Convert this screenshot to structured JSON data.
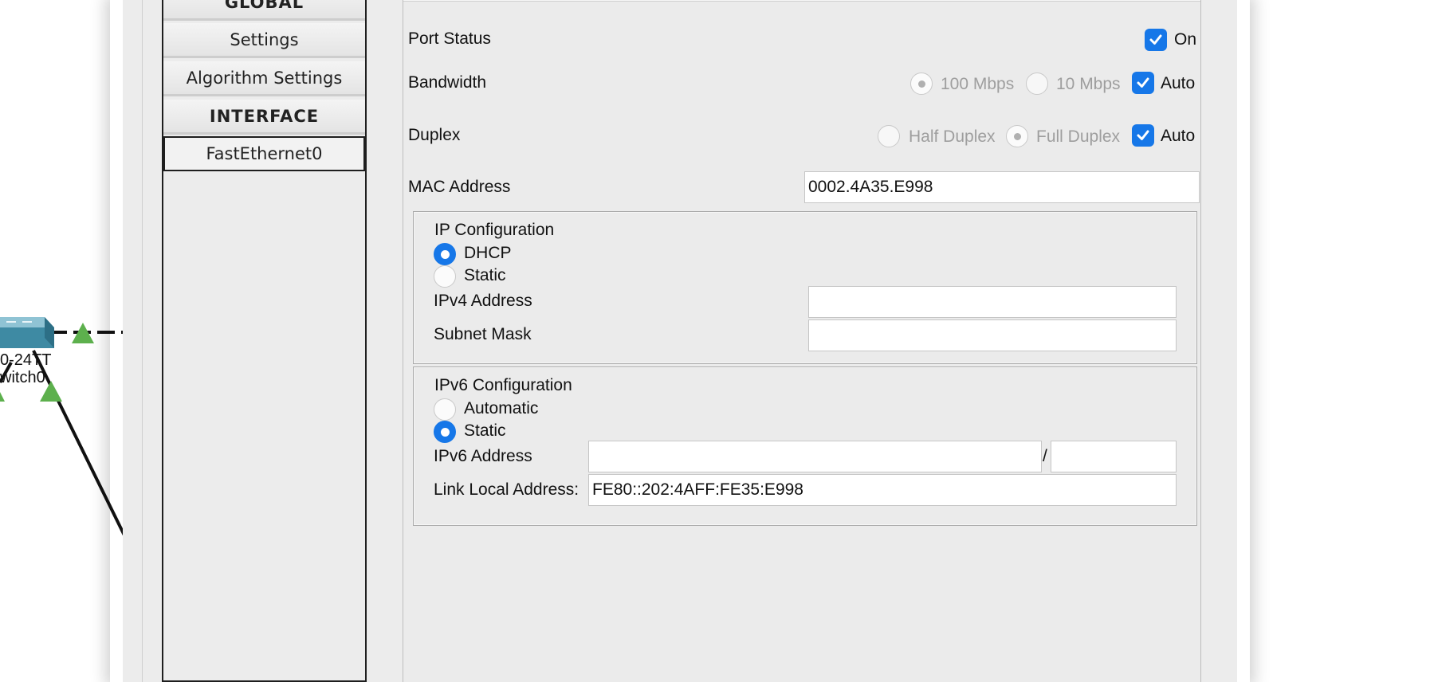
{
  "canvas": {
    "device_label_line1": "0-24TT",
    "device_label_line2": "witch0"
  },
  "nav": {
    "global_header": "GLOBAL",
    "settings": "Settings",
    "algorithm_settings": "Algorithm Settings",
    "interface_header": "INTERFACE",
    "fastethernet0": "FastEthernet0"
  },
  "port_status": {
    "label": "Port Status",
    "on_label": "On",
    "on_checked": true
  },
  "bandwidth": {
    "label": "Bandwidth",
    "opt_100": "100 Mbps",
    "opt_10": "10 Mbps",
    "auto_label": "Auto"
  },
  "duplex": {
    "label": "Duplex",
    "opt_half": "Half Duplex",
    "opt_full": "Full Duplex",
    "auto_label": "Auto"
  },
  "mac": {
    "label": "MAC Address",
    "value": "0002.4A35.E998"
  },
  "ip_config": {
    "title": "IP Configuration",
    "dhcp": "DHCP",
    "static": "Static",
    "ipv4_label": "IPv4 Address",
    "ipv4_value": "",
    "subnet_label": "Subnet Mask",
    "subnet_value": ""
  },
  "ipv6_config": {
    "title": "IPv6 Configuration",
    "automatic": "Automatic",
    "static": "Static",
    "ipv6_label": "IPv6 Address",
    "ipv6_value": "",
    "slash": "/",
    "prefix_value": "",
    "link_local_label": "Link Local Address:",
    "link_local_value": "FE80::202:4AFF:FE35:E998"
  },
  "colors": {
    "accent": "#1677e8",
    "link_up": "#5db04d"
  }
}
